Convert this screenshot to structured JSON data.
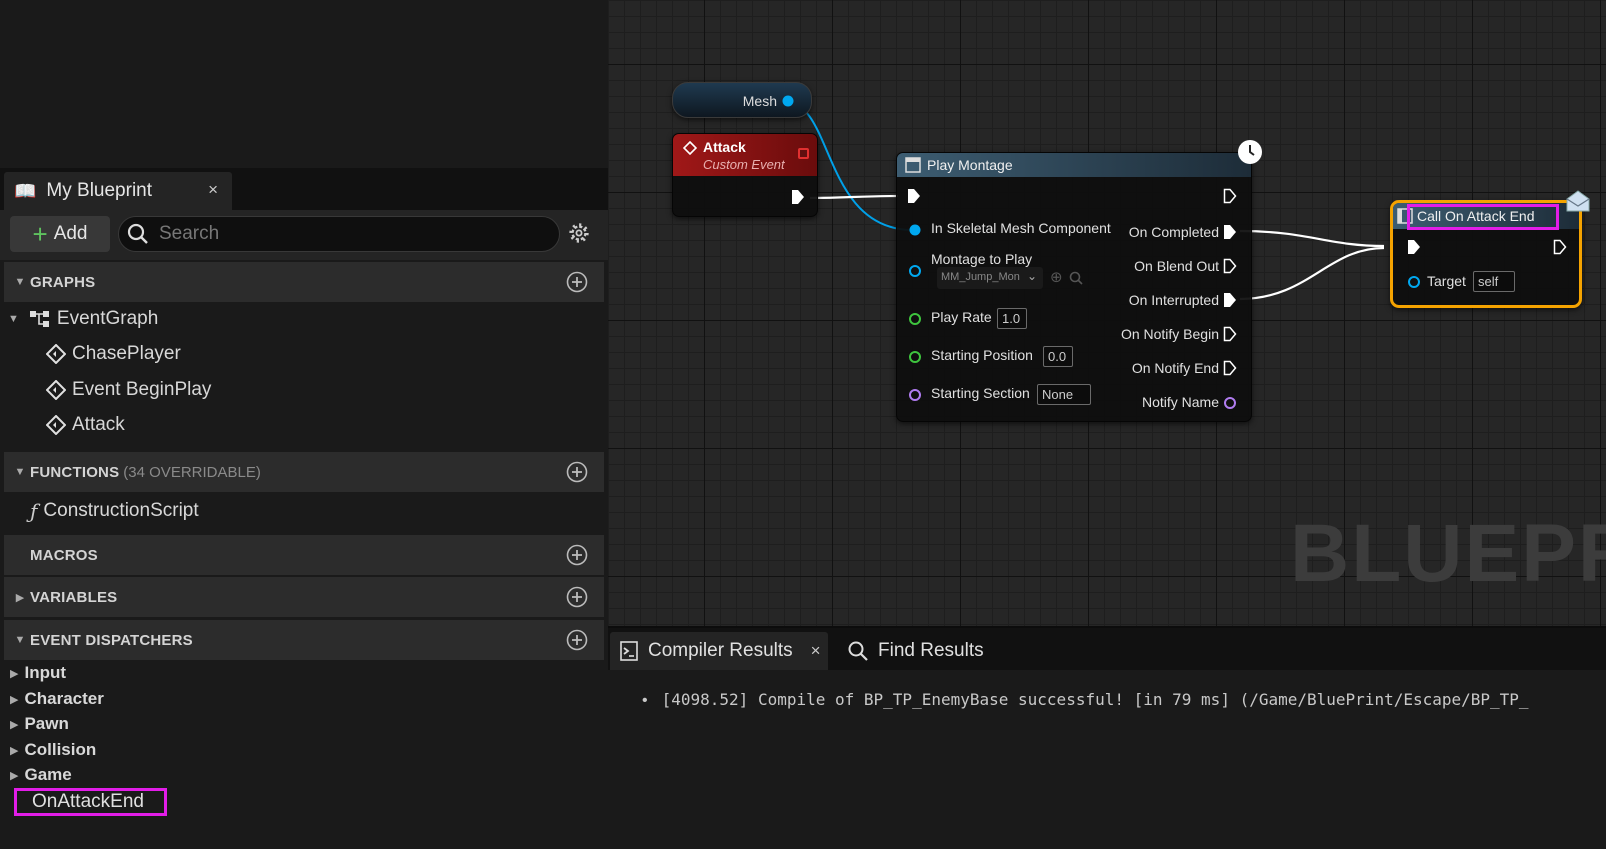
{
  "blueprint_panel": {
    "tab_label": "My Blueprint",
    "tab_close": "×",
    "add_label": "Add",
    "search_placeholder": "Search",
    "sections": {
      "graphs": "GRAPHS",
      "functions": "FUNCTIONS",
      "functions_sub": "(34 OVERRIDABLE)",
      "macros": "MACROS",
      "variables": "VARIABLES",
      "event_dispatchers": "EVENT DISPATCHERS"
    },
    "graphs": {
      "event_graph": "EventGraph",
      "events": [
        "ChasePlayer",
        "Event BeginPlay",
        "Attack"
      ]
    },
    "functions": [
      "ConstructionScript"
    ],
    "dispatcher_categories": [
      "Input",
      "Character",
      "Pawn",
      "Collision",
      "Game"
    ],
    "dispatcher_selected": "OnAttackEnd"
  },
  "graph": {
    "watermark": "BLUEPRI",
    "mesh_node": {
      "label": "Mesh"
    },
    "attack_node": {
      "title": "Attack",
      "subtitle": "Custom Event"
    },
    "play_montage": {
      "title": "Play Montage",
      "inputs": {
        "skeletal_mesh": "In Skeletal Mesh Component",
        "montage": "Montage to Play",
        "montage_value": "MM_Jump_Mon",
        "play_rate": "Play Rate",
        "play_rate_value": "1.0",
        "start_pos": "Starting Position",
        "start_pos_value": "0.0",
        "start_section": "Starting Section",
        "start_section_value": "None"
      },
      "outputs": [
        "On Completed",
        "On Blend Out",
        "On Interrupted",
        "On Notify Begin",
        "On Notify End",
        "Notify Name"
      ]
    },
    "call_node": {
      "title": "Call On Attack End",
      "target_label": "Target",
      "target_value": "self"
    },
    "colors": {
      "exec": "#ffffff",
      "object": "#00a8f0",
      "float": "#3ec43e",
      "name": "#b07cf0",
      "highlight": "#e21de8",
      "selection": "#f5a300"
    }
  },
  "bottom_panel": {
    "tab_compiler": "Compiler Results",
    "tab_close": "×",
    "tab_find": "Find Results",
    "log": "[4098.52] Compile of BP_TP_EnemyBase successful! [in 79 ms] (/Game/BluePrint/Escape/BP_TP_"
  }
}
